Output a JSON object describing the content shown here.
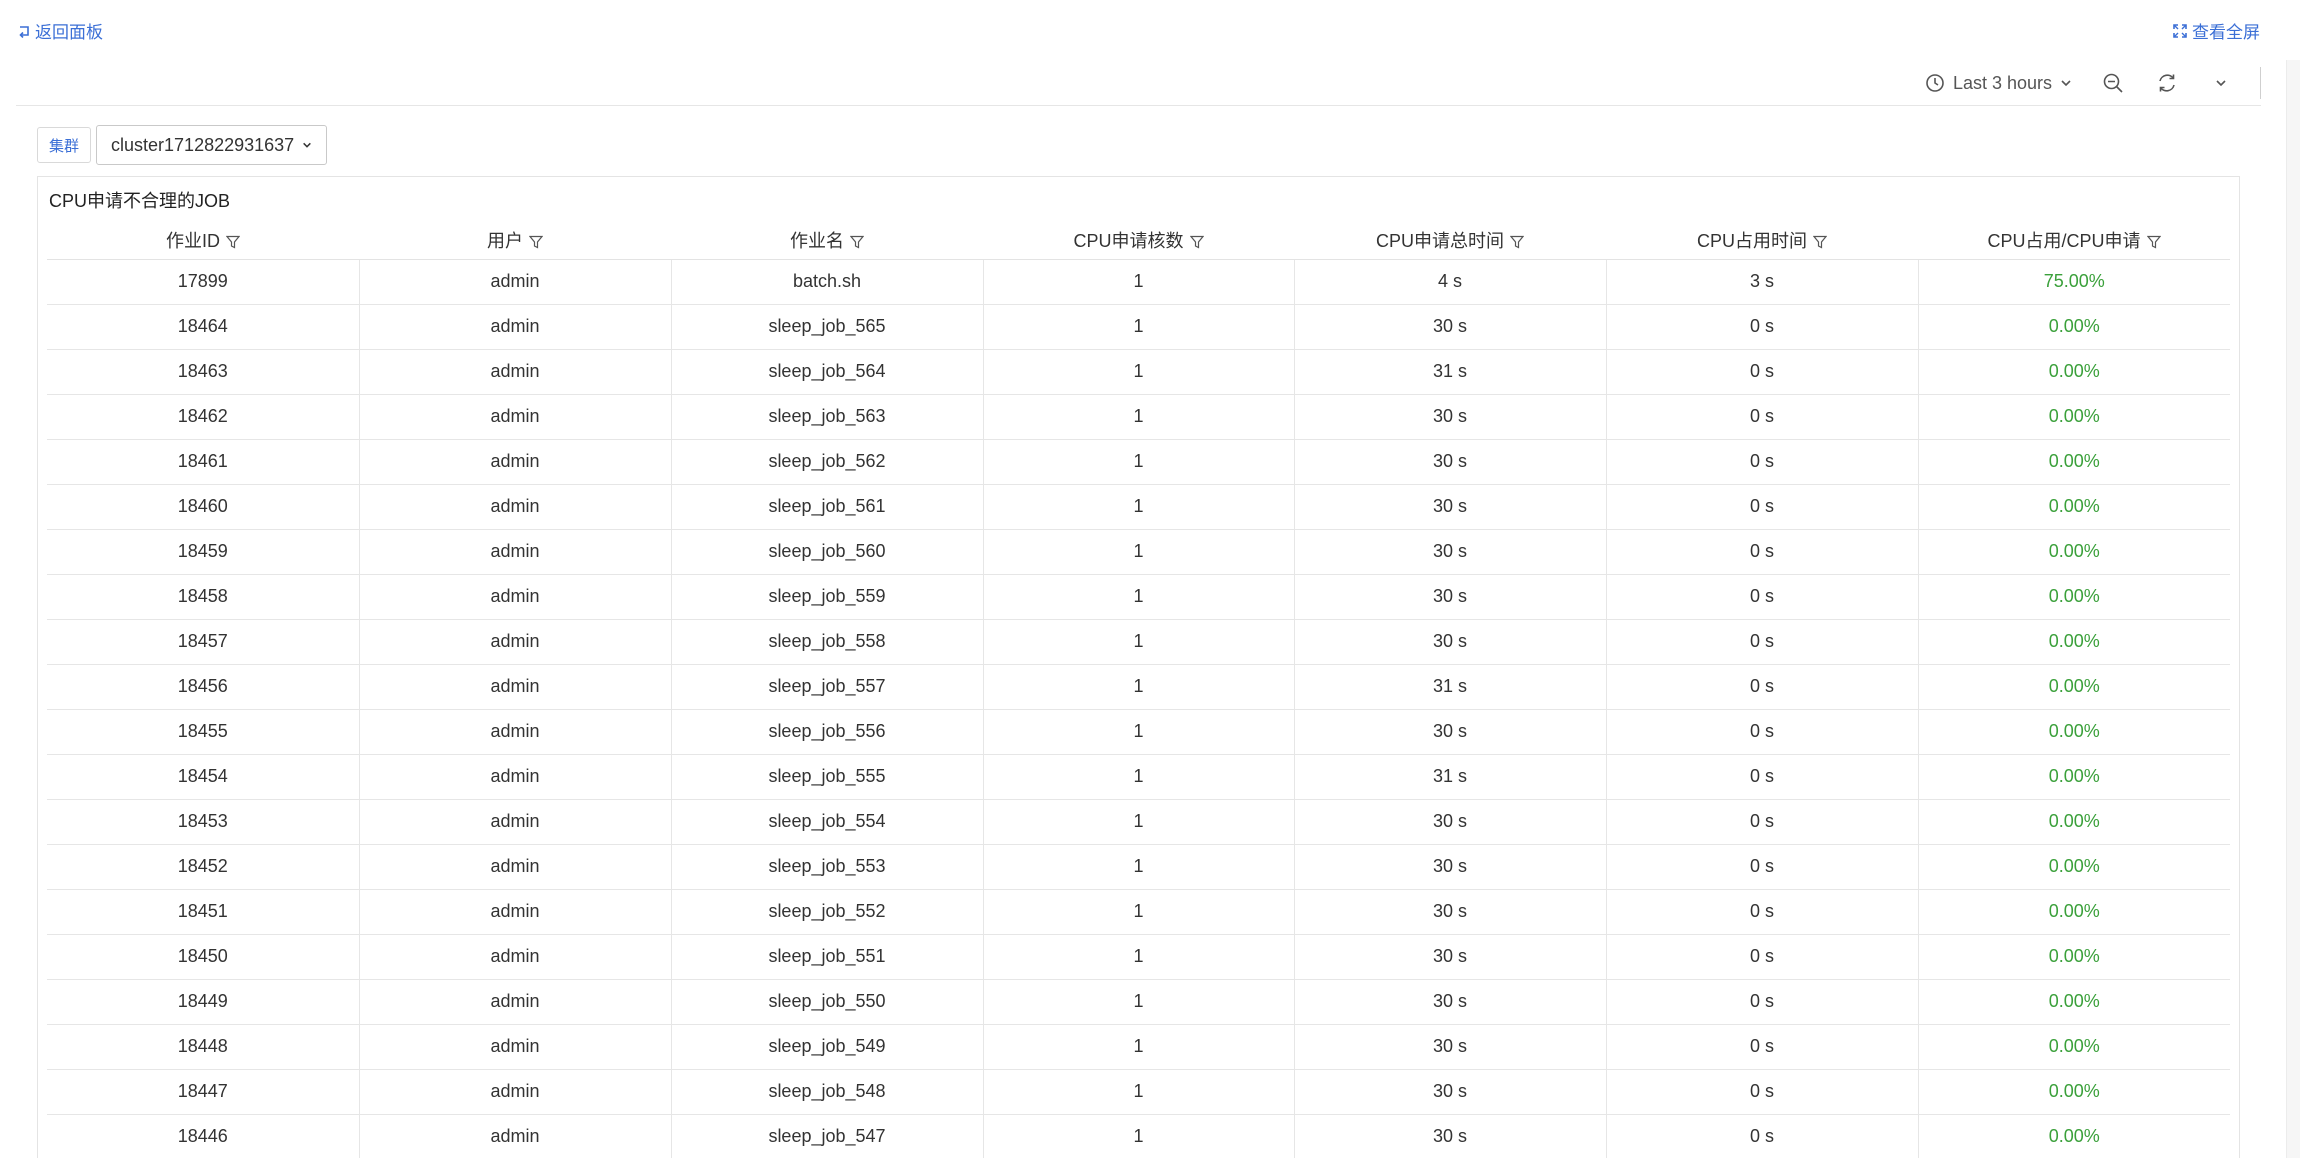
{
  "topbar": {
    "back_label": "返回面板",
    "fullscreen_label": "查看全屏"
  },
  "toolbar": {
    "time_range": "Last 3 hours"
  },
  "filter": {
    "label": "集群",
    "selected": "cluster1712822931637"
  },
  "panel": {
    "title": "CPU申请不合理的JOB"
  },
  "table": {
    "columns": [
      "作业ID",
      "用户",
      "作业名",
      "CPU申请核数",
      "CPU申请总时间",
      "CPU占用时间",
      "CPU占用/CPU申请"
    ],
    "rows": [
      [
        "17899",
        "admin",
        "batch.sh",
        "1",
        "4 s",
        "3 s",
        "75.00%"
      ],
      [
        "18464",
        "admin",
        "sleep_job_565",
        "1",
        "30 s",
        "0 s",
        "0.00%"
      ],
      [
        "18463",
        "admin",
        "sleep_job_564",
        "1",
        "31 s",
        "0 s",
        "0.00%"
      ],
      [
        "18462",
        "admin",
        "sleep_job_563",
        "1",
        "30 s",
        "0 s",
        "0.00%"
      ],
      [
        "18461",
        "admin",
        "sleep_job_562",
        "1",
        "30 s",
        "0 s",
        "0.00%"
      ],
      [
        "18460",
        "admin",
        "sleep_job_561",
        "1",
        "30 s",
        "0 s",
        "0.00%"
      ],
      [
        "18459",
        "admin",
        "sleep_job_560",
        "1",
        "30 s",
        "0 s",
        "0.00%"
      ],
      [
        "18458",
        "admin",
        "sleep_job_559",
        "1",
        "30 s",
        "0 s",
        "0.00%"
      ],
      [
        "18457",
        "admin",
        "sleep_job_558",
        "1",
        "30 s",
        "0 s",
        "0.00%"
      ],
      [
        "18456",
        "admin",
        "sleep_job_557",
        "1",
        "31 s",
        "0 s",
        "0.00%"
      ],
      [
        "18455",
        "admin",
        "sleep_job_556",
        "1",
        "30 s",
        "0 s",
        "0.00%"
      ],
      [
        "18454",
        "admin",
        "sleep_job_555",
        "1",
        "31 s",
        "0 s",
        "0.00%"
      ],
      [
        "18453",
        "admin",
        "sleep_job_554",
        "1",
        "30 s",
        "0 s",
        "0.00%"
      ],
      [
        "18452",
        "admin",
        "sleep_job_553",
        "1",
        "30 s",
        "0 s",
        "0.00%"
      ],
      [
        "18451",
        "admin",
        "sleep_job_552",
        "1",
        "30 s",
        "0 s",
        "0.00%"
      ],
      [
        "18450",
        "admin",
        "sleep_job_551",
        "1",
        "30 s",
        "0 s",
        "0.00%"
      ],
      [
        "18449",
        "admin",
        "sleep_job_550",
        "1",
        "30 s",
        "0 s",
        "0.00%"
      ],
      [
        "18448",
        "admin",
        "sleep_job_549",
        "1",
        "30 s",
        "0 s",
        "0.00%"
      ],
      [
        "18447",
        "admin",
        "sleep_job_548",
        "1",
        "30 s",
        "0 s",
        "0.00%"
      ],
      [
        "18446",
        "admin",
        "sleep_job_547",
        "1",
        "30 s",
        "0 s",
        "0.00%"
      ]
    ]
  },
  "colors": {
    "link": "#3b6fd6",
    "ratio": "#3aa03a"
  },
  "icons": {
    "back": "return-arrow-icon",
    "fullscreen": "expand-icon",
    "clock": "clock-icon",
    "zoom_out": "zoom-out-icon",
    "refresh": "refresh-icon",
    "chevron": "chevron-down-icon",
    "filter": "filter-icon"
  }
}
